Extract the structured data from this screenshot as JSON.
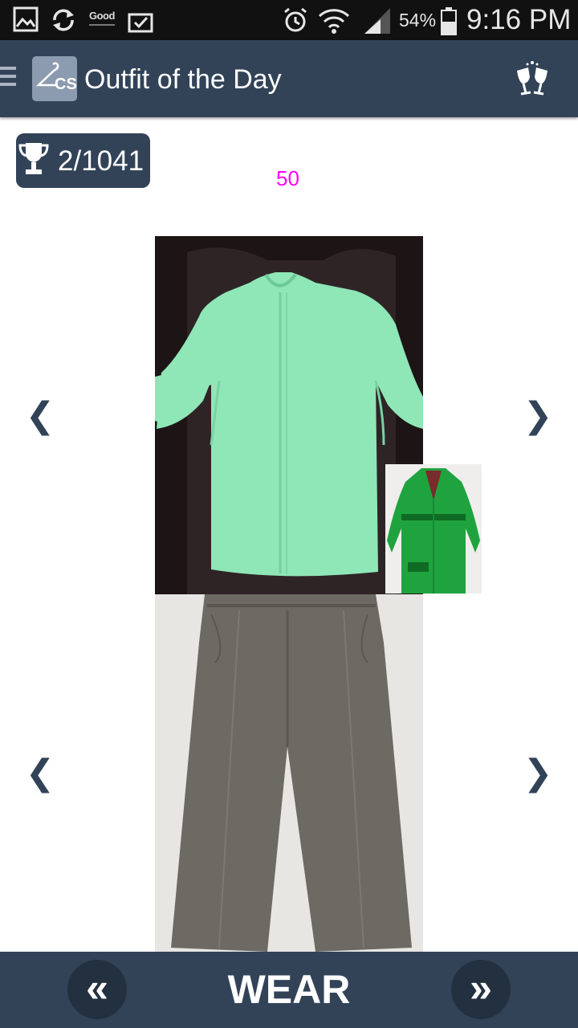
{
  "status_bar": {
    "good_label": "Good",
    "battery_percent": "54%",
    "time": "9:16 PM"
  },
  "app_bar": {
    "logo_text": "CS",
    "title": "Outfit of the Day",
    "menu_icon": "hamburger-menu-icon",
    "action_icon": "cheers-glasses-icon"
  },
  "score": {
    "text": "2/1041",
    "icon": "trophy-icon"
  },
  "count_label": "50",
  "nav": {
    "prev_glyph": "❮",
    "next_glyph": "❯"
  },
  "bottom_bar": {
    "prev_glyph": "«",
    "wear_label": "WEAR",
    "next_glyph": "»"
  },
  "colors": {
    "primary": "#324358",
    "accent_count": "#ff00ff",
    "blouse": "#8fe6b6",
    "trousers": "#6d6a64",
    "coat": "#1fa33e"
  }
}
